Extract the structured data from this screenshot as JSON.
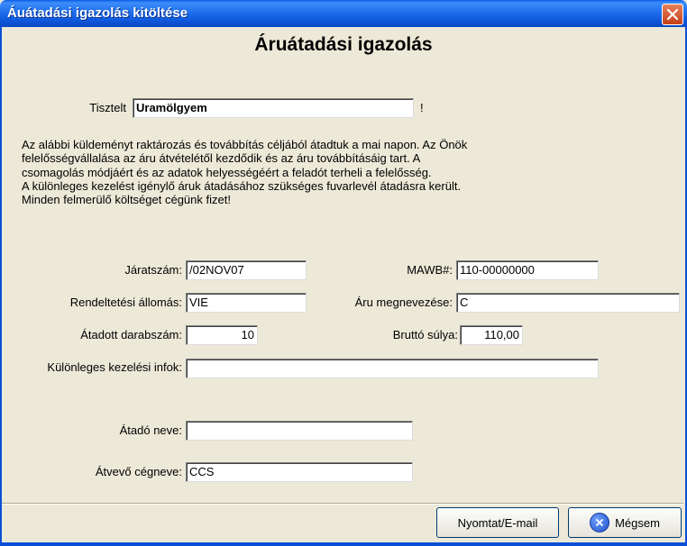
{
  "window": {
    "title": "Áuátadási igazolás kitöltése"
  },
  "heading": "Áruátadási igazolás",
  "salutation": {
    "label": "Tisztelt",
    "value": "Uramölgyem",
    "suffix": "!"
  },
  "paragraph": [
    "Az alábbi küldeményt raktározás és továbbítás céljából átadtuk a mai napon. Az Önök",
    "felelősségvállalása az áru átvételétől kezdődik és az áru továbbításáig tart. A",
    "csomagolás módjáért és az adatok helyességéért a feladót terheli a felelősség.",
    "A különleges kezelést igénylő áruk átadásához szükséges fuvarlevél átadásra került.",
    "Minden felmerülő költséget cégünk fizet!"
  ],
  "fields": {
    "jarat": {
      "label": "Járatszám:",
      "value": "/02NOV07"
    },
    "mawb": {
      "label": "MAWB#:",
      "value": "110-00000000"
    },
    "rendeltetes": {
      "label": "Rendeltetési állomás:",
      "value": "VIE"
    },
    "megnevezes": {
      "label": "Áru megnevezése:",
      "value": "C"
    },
    "darab": {
      "label": "Átadott darabszám:",
      "value": "10"
    },
    "brutto": {
      "label": "Bruttó súlya:",
      "value": "110,00"
    },
    "kulonleges": {
      "label": "Különleges kezelési infok:",
      "value": ""
    },
    "atado": {
      "label": "Átadó neve:",
      "value": ""
    },
    "atvevo": {
      "label": "Átvevő cégneve:",
      "value": "CCS"
    }
  },
  "buttons": {
    "print": "Nyomtat/E-mail",
    "cancel": "Mégsem"
  }
}
